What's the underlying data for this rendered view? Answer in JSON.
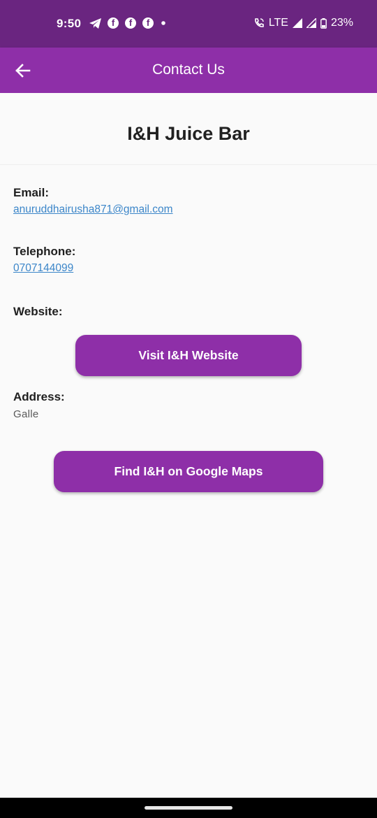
{
  "status_bar": {
    "time": "9:50",
    "network": "LTE",
    "battery": "23%"
  },
  "app_bar": {
    "title": "Contact Us",
    "back_icon": "arrow-left-icon"
  },
  "business": {
    "name": "I&H Juice Bar"
  },
  "contact": {
    "email_label": "Email:",
    "email_value": "anuruddhairusha871@gmail.com",
    "telephone_label": "Telephone:",
    "telephone_value": "0707144099",
    "website_label": "Website:",
    "website_button": "Visit I&H Website",
    "address_label": "Address:",
    "address_value": "Galle",
    "maps_button": "Find I&H on Google Maps"
  },
  "colors": {
    "status_bar": "#6a2580",
    "app_bar": "#8e2fa8",
    "button": "#8e2fa8",
    "link": "#3c86c9"
  }
}
